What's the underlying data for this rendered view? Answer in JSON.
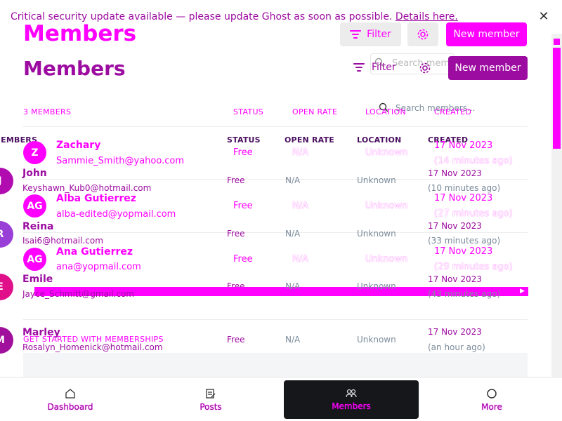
{
  "banner": {
    "text": "Critical security update available — please update Ghost as soon as possible.",
    "link": "Details here."
  },
  "header": {
    "title": "Members",
    "filter_label": "Filter",
    "new_member_label": "New member",
    "search_placeholder": "Search members..."
  },
  "table": {
    "count_label": "3 MEMBERS",
    "count_label_b": "MEMBERS",
    "columns": {
      "status": "STATUS",
      "open_rate": "OPEN RATE",
      "location": "LOCATION",
      "created": "CREATED"
    }
  },
  "ghost_rows": [
    {
      "initials": "Z",
      "name": "Zachary",
      "email": "Sammie_Smith@yahoo.com",
      "status": "Free",
      "open_rate": "N/A",
      "location": "Unknown",
      "created": "17 Nov 2023",
      "ago": "(14 minutes ago)"
    },
    {
      "initials": "AG",
      "name": "Alba Gutierrez",
      "email": "alba-edited@yopmail.com",
      "status": "Free",
      "open_rate": "N/A",
      "location": "Unknown",
      "created": "17 Nov 2023",
      "ago": "(27 minutes ago)"
    },
    {
      "initials": "AG",
      "name": "Ana Gutierrez",
      "email": "ana@yopmail.com",
      "status": "Free",
      "open_rate": "N/A",
      "location": "Unknown",
      "created": "17 Nov 2023",
      "ago": "(29 minutes ago)"
    }
  ],
  "rows": [
    {
      "initials": "J",
      "color": "#b00cb0",
      "name": "John",
      "email": "Keyshawn_Kub0@hotmail.com",
      "status": "Free",
      "open_rate": "N/A",
      "location": "Unknown",
      "created": "17 Nov 2023",
      "ago": "(10 minutes ago)"
    },
    {
      "initials": "R",
      "color": "#9a3ed8",
      "name": "Reina",
      "email": "Isai6@hotmail.com",
      "status": "Free",
      "open_rate": "N/A",
      "location": "Unknown",
      "created": "17 Nov 2023",
      "ago": "(33 minutes ago)"
    },
    {
      "initials": "E",
      "color": "#e0108a",
      "name": "Emile",
      "email": "Jayce_Schmitt@gmail.com",
      "status": "Free",
      "open_rate": "N/A",
      "location": "Unknown",
      "created": "17 Nov 2023",
      "ago": "(43 minutes ago)"
    },
    {
      "initials": "M",
      "color": "#a0109c",
      "name": "Marley",
      "email": "Rosalyn_Homenick@hotmail.com",
      "status": "Free",
      "open_rate": "N/A",
      "location": "Unknown",
      "created": "17 Nov 2023",
      "ago": "(an hour ago)"
    }
  ],
  "get_started": "GET STARTED WITH MEMBERSHIPS",
  "nav": [
    {
      "label": "Dashboard",
      "icon": "home-icon"
    },
    {
      "label": "Posts",
      "icon": "posts-icon"
    },
    {
      "label": "Members",
      "icon": "members-icon",
      "active": true
    },
    {
      "label": "More",
      "icon": "more-icon"
    }
  ],
  "colors": {
    "accent": "#ff00ff",
    "purple": "#9c0ca0",
    "nav_active_bg": "#15171a"
  }
}
